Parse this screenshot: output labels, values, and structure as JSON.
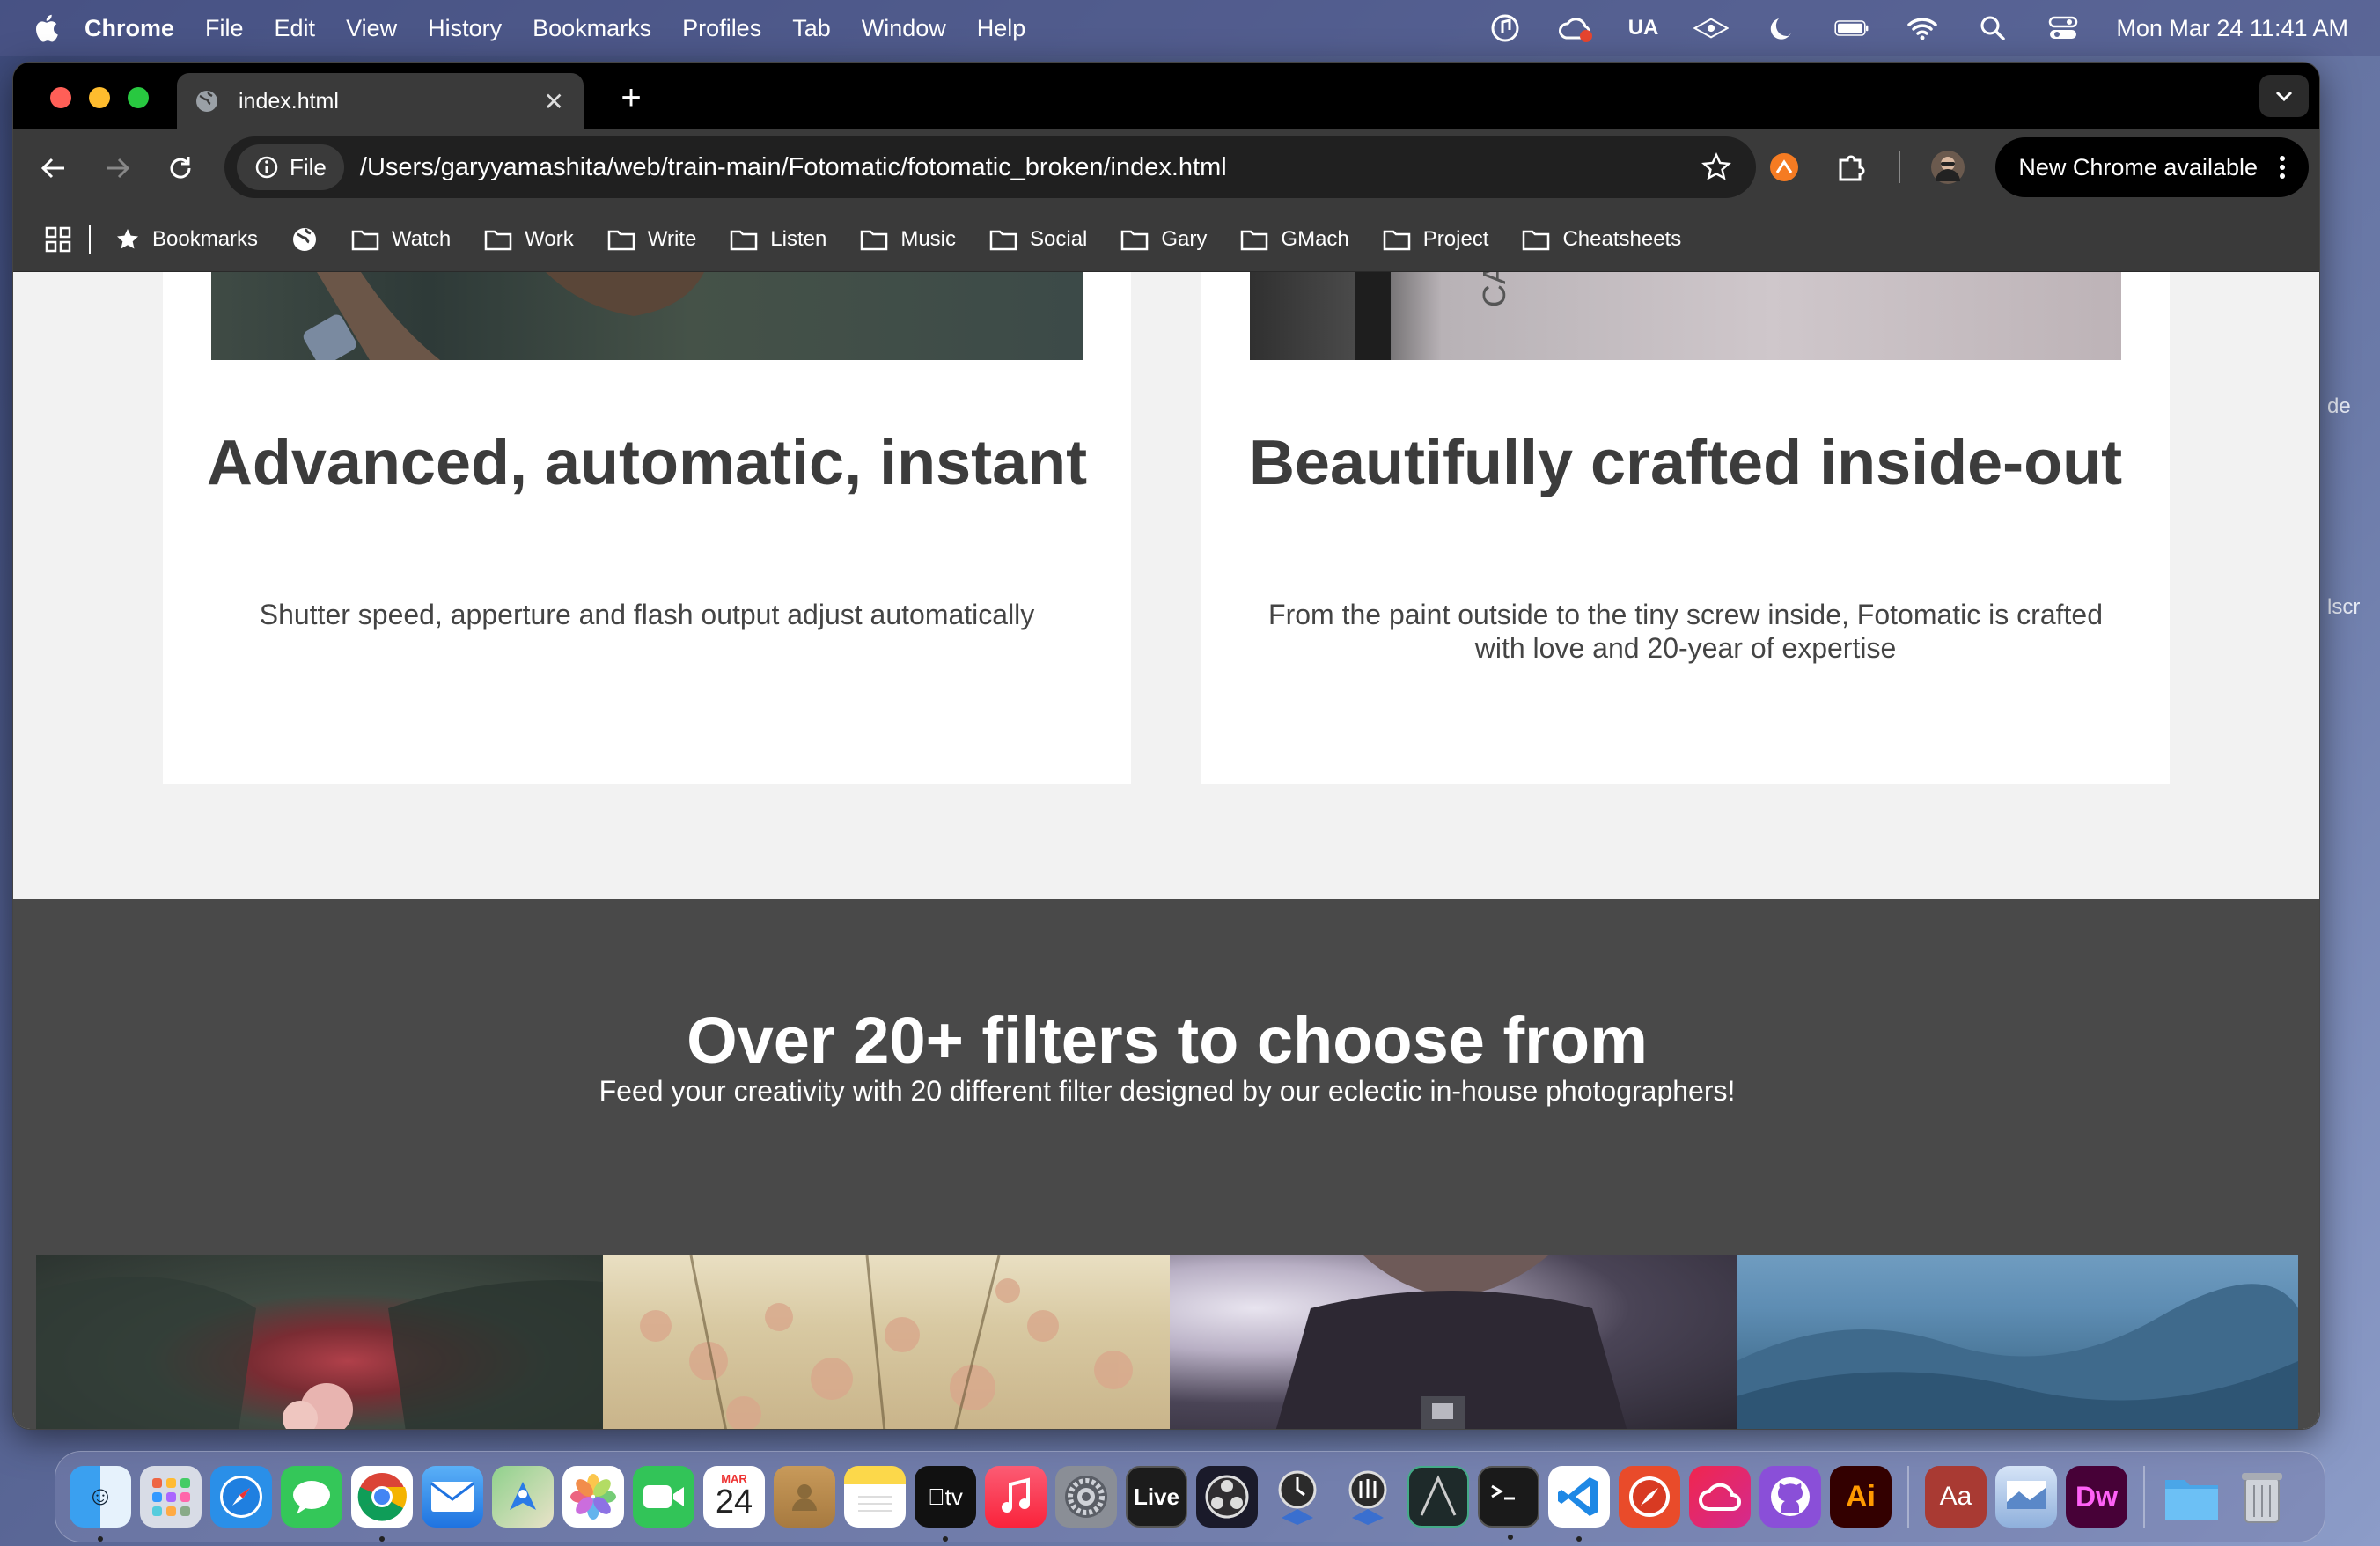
{
  "menubar": {
    "app": "Chrome",
    "items": [
      "File",
      "Edit",
      "View",
      "History",
      "Bookmarks",
      "Profiles",
      "Tab",
      "Window",
      "Help"
    ],
    "ua": "UA",
    "clock": "Mon Mar 24  11:41 AM"
  },
  "desktop_labels": [
    "de",
    "lscr"
  ],
  "tab": {
    "title": "index.html"
  },
  "toolbar": {
    "chip": "File",
    "url": "/Users/garyyamashita/web/train-main/Fotomatic/fotomatic_broken/index.html",
    "update": "New Chrome available"
  },
  "bookmarks": {
    "first": "Bookmarks",
    "folders": [
      "Watch",
      "Work",
      "Write",
      "Listen",
      "Music",
      "Social",
      "Gary",
      "GMach",
      "Project",
      "Cheatsheets"
    ]
  },
  "page": {
    "card1": {
      "title": "Advanced, automatic, instant",
      "text": "Shutter speed, apperture and flash output adjust automatically"
    },
    "card2": {
      "title": "Beautifully crafted inside-out",
      "text": "From the paint outside to the tiny screw inside, Fotomatic is crafted with love and 20-year of expertise"
    },
    "section": {
      "title": "Over 20+ filters to choose from",
      "subtitle": "Feed your creativity with 20 different filter designed by our eclectic in-house photographers!"
    }
  },
  "dock": {
    "calendar_month": "MAR",
    "calendar_day": "24",
    "tv": "tv",
    "live": "Live",
    "ai": "Ai",
    "aa": "Aa",
    "dw": "Dw"
  },
  "colors": {
    "accent_dark": "#494949",
    "card_title": "#3c3c3c",
    "page_bg": "#f2f2f2"
  }
}
